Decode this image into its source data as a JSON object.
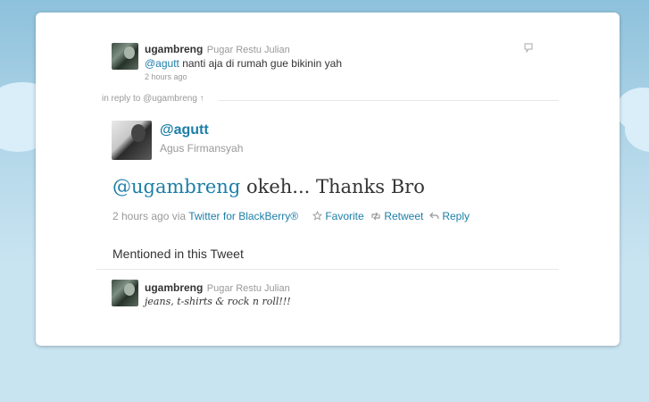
{
  "parent_tweet": {
    "username": "ugambreng",
    "realname": "Pugar Restu Julian",
    "mention": "@agutt",
    "text": " nanti aja di rumah gue bikinin yah",
    "time": "2 hours ago"
  },
  "in_reply_to": "in reply to @ugambreng ↑",
  "main_tweet": {
    "handle": "@agutt",
    "realname": "Agus Firmansyah",
    "mention": "@ugambreng",
    "text": " okeh... Thanks Bro",
    "time": "2 hours ago",
    "via": "via",
    "client": "Twitter for BlackBerry®",
    "actions": {
      "favorite": "Favorite",
      "retweet": "Retweet",
      "reply": "Reply"
    }
  },
  "mentioned": {
    "heading": "Mentioned in this Tweet",
    "username": "ugambreng",
    "realname": "Pugar Restu Julian",
    "bio": "jeans, t-shirts & rock n roll!!!"
  },
  "icons": {
    "conversation": "speech-bubble-icon",
    "favorite": "star-icon",
    "retweet": "retweet-icon",
    "reply": "reply-arrow-icon"
  }
}
